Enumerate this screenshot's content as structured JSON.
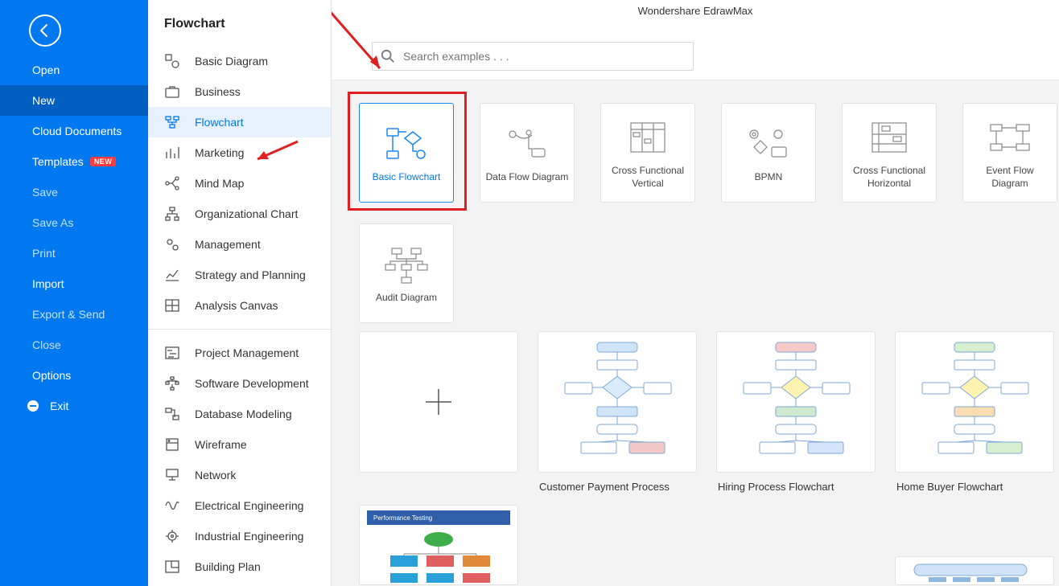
{
  "app_title": "Wondershare EdrawMax",
  "sidebar_left": {
    "open": "Open",
    "new": "New",
    "cloud_documents": "Cloud Documents",
    "templates": "Templates",
    "templates_badge": "NEW",
    "save": "Save",
    "save_as": "Save As",
    "print": "Print",
    "import": "Import",
    "export_send": "Export & Send",
    "close": "Close",
    "options": "Options",
    "exit": "Exit"
  },
  "category_panel": {
    "title": "Flowchart",
    "groups": [
      {
        "items": [
          {
            "label": "Basic Diagram",
            "icon": "shapes"
          },
          {
            "label": "Business",
            "icon": "briefcase"
          },
          {
            "label": "Flowchart",
            "icon": "flow",
            "selected": true
          },
          {
            "label": "Marketing",
            "icon": "bars"
          },
          {
            "label": "Mind Map",
            "icon": "mindmap"
          },
          {
            "label": "Organizational Chart",
            "icon": "org"
          },
          {
            "label": "Management",
            "icon": "gears"
          },
          {
            "label": "Strategy and Planning",
            "icon": "chartline"
          },
          {
            "label": "Analysis Canvas",
            "icon": "grid"
          }
        ]
      },
      {
        "items": [
          {
            "label": "Project Management",
            "icon": "gantt"
          },
          {
            "label": "Software Development",
            "icon": "tree"
          },
          {
            "label": "Database Modeling",
            "icon": "db"
          },
          {
            "label": "Wireframe",
            "icon": "wire"
          },
          {
            "label": "Network",
            "icon": "network"
          },
          {
            "label": "Electrical Engineering",
            "icon": "wave"
          },
          {
            "label": "Industrial Engineering",
            "icon": "industry"
          },
          {
            "label": "Building Plan",
            "icon": "plan"
          }
        ]
      }
    ]
  },
  "search": {
    "placeholder": "Search examples . . ."
  },
  "template_tiles": [
    {
      "label": "Basic Flowchart",
      "icon": "basic-flowchart",
      "selected": true,
      "highlighted": true
    },
    {
      "label": "Data Flow Diagram",
      "icon": "dfd"
    },
    {
      "label": "Cross Functional Vertical",
      "icon": "cfv"
    },
    {
      "label": "BPMN",
      "icon": "bpmn"
    },
    {
      "label": "Cross Functional Horizontal",
      "icon": "cfh"
    },
    {
      "label": "Event Flow Diagram",
      "icon": "efd"
    }
  ],
  "template_tiles_row2": [
    {
      "label": "Audit Diagram",
      "icon": "audit"
    }
  ],
  "examples": [
    {
      "label": "",
      "is_blank": true
    },
    {
      "label": "Customer Payment Process"
    },
    {
      "label": "Hiring Process Flowchart"
    },
    {
      "label": "Home Buyer Flowchart"
    }
  ],
  "examples_row2": [
    {
      "label": "Performance Testing"
    }
  ]
}
